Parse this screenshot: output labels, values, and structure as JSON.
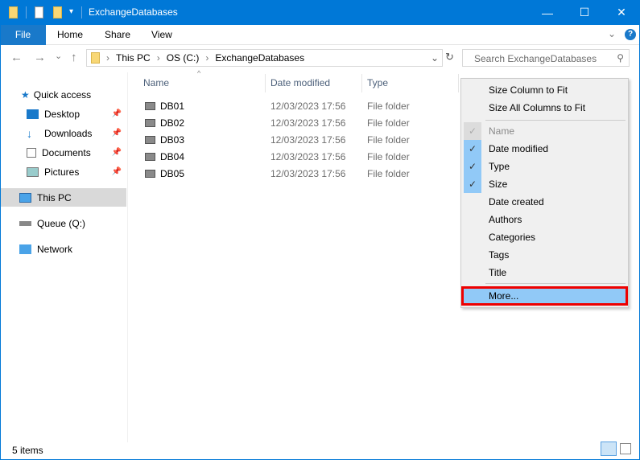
{
  "window": {
    "title": "ExchangeDatabases",
    "minimize": "—",
    "maximize": "☐",
    "close": "✕"
  },
  "ribbon": {
    "tabs": [
      "File",
      "Home",
      "Share",
      "View"
    ],
    "collapse": "⌄",
    "help": "?"
  },
  "nav": {
    "back": "←",
    "forward": "→",
    "recent": "⌄",
    "up": "↑",
    "breadcrumb": [
      "This PC",
      "OS (C:)",
      "ExchangeDatabases"
    ],
    "refresh": "↻",
    "dropdown": "⌄",
    "search_placeholder": "Search ExchangeDatabases"
  },
  "sidebar": {
    "quick_access": "Quick access",
    "items": [
      "Desktop",
      "Downloads",
      "Documents",
      "Pictures"
    ],
    "this_pc": "This PC",
    "queue": "Queue (Q:)",
    "network": "Network"
  },
  "columns": [
    "Name",
    "Date modified",
    "Type"
  ],
  "files": [
    {
      "name": "DB01",
      "date": "12/03/2023 17:56",
      "type": "File folder"
    },
    {
      "name": "DB02",
      "date": "12/03/2023 17:56",
      "type": "File folder"
    },
    {
      "name": "DB03",
      "date": "12/03/2023 17:56",
      "type": "File folder"
    },
    {
      "name": "DB04",
      "date": "12/03/2023 17:56",
      "type": "File folder"
    },
    {
      "name": "DB05",
      "date": "12/03/2023 17:56",
      "type": "File folder"
    }
  ],
  "menu": {
    "size_col": "Size Column to Fit",
    "size_all": "Size All Columns to Fit",
    "items": [
      {
        "label": "Name",
        "checked": true,
        "disabled": true
      },
      {
        "label": "Date modified",
        "checked": true
      },
      {
        "label": "Type",
        "checked": true
      },
      {
        "label": "Size",
        "checked": true
      },
      {
        "label": "Date created",
        "checked": false
      },
      {
        "label": "Authors",
        "checked": false
      },
      {
        "label": "Categories",
        "checked": false
      },
      {
        "label": "Tags",
        "checked": false
      },
      {
        "label": "Title",
        "checked": false
      }
    ],
    "more": "More..."
  },
  "status": {
    "items": "5 items"
  }
}
